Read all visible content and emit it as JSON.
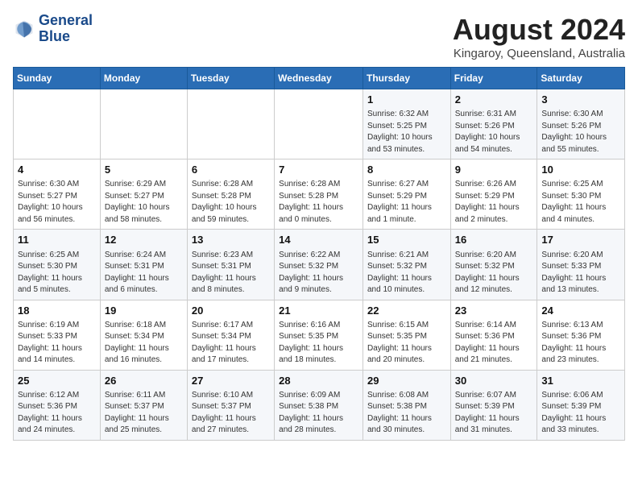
{
  "logo": {
    "line1": "General",
    "line2": "Blue"
  },
  "title": "August 2024",
  "location": "Kingaroy, Queensland, Australia",
  "days_header": [
    "Sunday",
    "Monday",
    "Tuesday",
    "Wednesday",
    "Thursday",
    "Friday",
    "Saturday"
  ],
  "weeks": [
    [
      {
        "day": "",
        "info": ""
      },
      {
        "day": "",
        "info": ""
      },
      {
        "day": "",
        "info": ""
      },
      {
        "day": "",
        "info": ""
      },
      {
        "day": "1",
        "info": "Sunrise: 6:32 AM\nSunset: 5:25 PM\nDaylight: 10 hours\nand 53 minutes."
      },
      {
        "day": "2",
        "info": "Sunrise: 6:31 AM\nSunset: 5:26 PM\nDaylight: 10 hours\nand 54 minutes."
      },
      {
        "day": "3",
        "info": "Sunrise: 6:30 AM\nSunset: 5:26 PM\nDaylight: 10 hours\nand 55 minutes."
      }
    ],
    [
      {
        "day": "4",
        "info": "Sunrise: 6:30 AM\nSunset: 5:27 PM\nDaylight: 10 hours\nand 56 minutes."
      },
      {
        "day": "5",
        "info": "Sunrise: 6:29 AM\nSunset: 5:27 PM\nDaylight: 10 hours\nand 58 minutes."
      },
      {
        "day": "6",
        "info": "Sunrise: 6:28 AM\nSunset: 5:28 PM\nDaylight: 10 hours\nand 59 minutes."
      },
      {
        "day": "7",
        "info": "Sunrise: 6:28 AM\nSunset: 5:28 PM\nDaylight: 11 hours\nand 0 minutes."
      },
      {
        "day": "8",
        "info": "Sunrise: 6:27 AM\nSunset: 5:29 PM\nDaylight: 11 hours\nand 1 minute."
      },
      {
        "day": "9",
        "info": "Sunrise: 6:26 AM\nSunset: 5:29 PM\nDaylight: 11 hours\nand 2 minutes."
      },
      {
        "day": "10",
        "info": "Sunrise: 6:25 AM\nSunset: 5:30 PM\nDaylight: 11 hours\nand 4 minutes."
      }
    ],
    [
      {
        "day": "11",
        "info": "Sunrise: 6:25 AM\nSunset: 5:30 PM\nDaylight: 11 hours\nand 5 minutes."
      },
      {
        "day": "12",
        "info": "Sunrise: 6:24 AM\nSunset: 5:31 PM\nDaylight: 11 hours\nand 6 minutes."
      },
      {
        "day": "13",
        "info": "Sunrise: 6:23 AM\nSunset: 5:31 PM\nDaylight: 11 hours\nand 8 minutes."
      },
      {
        "day": "14",
        "info": "Sunrise: 6:22 AM\nSunset: 5:32 PM\nDaylight: 11 hours\nand 9 minutes."
      },
      {
        "day": "15",
        "info": "Sunrise: 6:21 AM\nSunset: 5:32 PM\nDaylight: 11 hours\nand 10 minutes."
      },
      {
        "day": "16",
        "info": "Sunrise: 6:20 AM\nSunset: 5:32 PM\nDaylight: 11 hours\nand 12 minutes."
      },
      {
        "day": "17",
        "info": "Sunrise: 6:20 AM\nSunset: 5:33 PM\nDaylight: 11 hours\nand 13 minutes."
      }
    ],
    [
      {
        "day": "18",
        "info": "Sunrise: 6:19 AM\nSunset: 5:33 PM\nDaylight: 11 hours\nand 14 minutes."
      },
      {
        "day": "19",
        "info": "Sunrise: 6:18 AM\nSunset: 5:34 PM\nDaylight: 11 hours\nand 16 minutes."
      },
      {
        "day": "20",
        "info": "Sunrise: 6:17 AM\nSunset: 5:34 PM\nDaylight: 11 hours\nand 17 minutes."
      },
      {
        "day": "21",
        "info": "Sunrise: 6:16 AM\nSunset: 5:35 PM\nDaylight: 11 hours\nand 18 minutes."
      },
      {
        "day": "22",
        "info": "Sunrise: 6:15 AM\nSunset: 5:35 PM\nDaylight: 11 hours\nand 20 minutes."
      },
      {
        "day": "23",
        "info": "Sunrise: 6:14 AM\nSunset: 5:36 PM\nDaylight: 11 hours\nand 21 minutes."
      },
      {
        "day": "24",
        "info": "Sunrise: 6:13 AM\nSunset: 5:36 PM\nDaylight: 11 hours\nand 23 minutes."
      }
    ],
    [
      {
        "day": "25",
        "info": "Sunrise: 6:12 AM\nSunset: 5:36 PM\nDaylight: 11 hours\nand 24 minutes."
      },
      {
        "day": "26",
        "info": "Sunrise: 6:11 AM\nSunset: 5:37 PM\nDaylight: 11 hours\nand 25 minutes."
      },
      {
        "day": "27",
        "info": "Sunrise: 6:10 AM\nSunset: 5:37 PM\nDaylight: 11 hours\nand 27 minutes."
      },
      {
        "day": "28",
        "info": "Sunrise: 6:09 AM\nSunset: 5:38 PM\nDaylight: 11 hours\nand 28 minutes."
      },
      {
        "day": "29",
        "info": "Sunrise: 6:08 AM\nSunset: 5:38 PM\nDaylight: 11 hours\nand 30 minutes."
      },
      {
        "day": "30",
        "info": "Sunrise: 6:07 AM\nSunset: 5:39 PM\nDaylight: 11 hours\nand 31 minutes."
      },
      {
        "day": "31",
        "info": "Sunrise: 6:06 AM\nSunset: 5:39 PM\nDaylight: 11 hours\nand 33 minutes."
      }
    ]
  ]
}
